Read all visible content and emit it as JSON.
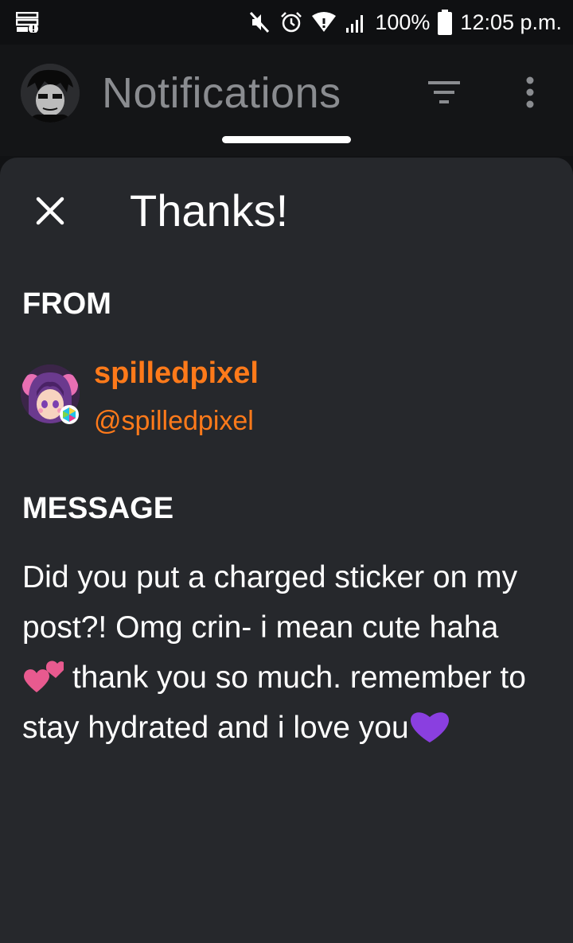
{
  "status_bar": {
    "battery": "100%",
    "time": "12:05 p.m."
  },
  "app_bar": {
    "title": "Notifications"
  },
  "sheet": {
    "title": "Thanks!",
    "from_label": "FROM",
    "sender": {
      "name": "spilledpixel",
      "handle": "@spilledpixel"
    },
    "message_label": "MESSAGE",
    "message_part1": "Did you put a charged sticker on my post?! Omg crin- i mean cute haha ",
    "message_part2": " thank you so much. remember to stay hydrated and i love you"
  },
  "colors": {
    "accent": "#ff7a1a",
    "sheet_bg": "#26282c",
    "appbar_bg": "#141517"
  },
  "icons": [
    "data-saver-icon",
    "mute-icon",
    "alarm-icon",
    "wifi-icon",
    "signal-icon",
    "battery-icon",
    "filter-icon",
    "more-vert-icon",
    "close-icon",
    "two-hearts-emoji",
    "purple-heart-emoji"
  ]
}
